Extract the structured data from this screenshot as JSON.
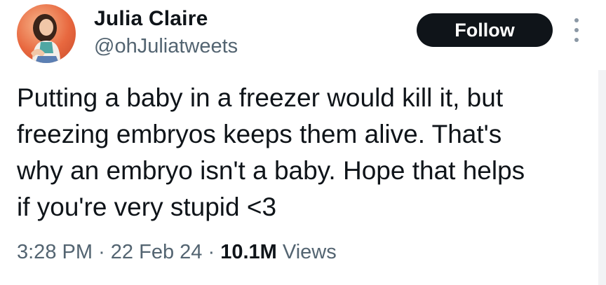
{
  "author": {
    "display_name": "Julia Claire",
    "handle": "@ohJuliatweets"
  },
  "actions": {
    "follow_label": "Follow",
    "more_icon": "more-vertical-icon"
  },
  "tweet": {
    "lines": [
      "Putting a baby in a freezer would kill it, but",
      "freezing embryos keeps them alive. That's",
      "why an embryo isn't a baby. Hope that helps",
      "if you're very stupid <3"
    ]
  },
  "meta": {
    "time": "3:28 PM",
    "separator": "·",
    "date": "22 Feb 24",
    "views_count": "10.1M",
    "views_label": "Views"
  },
  "colors": {
    "text_primary": "#0f1419",
    "text_secondary": "#536471",
    "follow_bg": "#0f1419",
    "avatar_bg": "#e8683f"
  }
}
